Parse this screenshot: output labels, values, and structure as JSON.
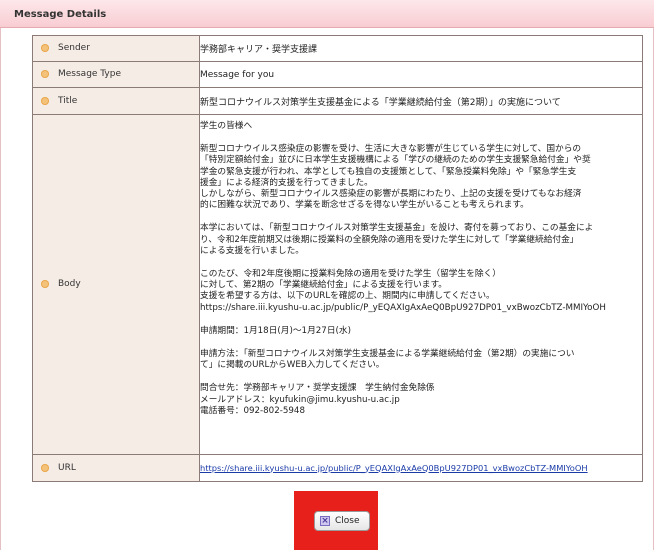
{
  "header": {
    "title": "Message Details"
  },
  "fields": {
    "sender": {
      "label": "Sender",
      "value": "学務部キャリア・奨学支援課"
    },
    "type": {
      "label": "Message Type",
      "value": "Message for you"
    },
    "title": {
      "label": "Title",
      "value": "新型コロナウイルス対策学生支援基金による「学業継続給付金（第2期）」の実施について"
    },
    "body": {
      "label": "Body",
      "greeting": "学生の皆様へ",
      "para1": [
        "新型コロナウイルス感染症の影響を受け、生活に大きな影響が生じている学生に対して、国からの",
        "「特別定額給付金」並びに日本学生支援機構による「学びの継続のための学生支援緊急給付金」や奨",
        "学金の緊急支援が行われ、本学としても独自の支援策として、「緊急授業料免除」や「緊急学生支",
        "援金」による経済的支援を行ってきました。",
        "しかしながら、新型コロナウイルス感染症の影響が長期にわたり、上記の支援を受けてもなお経済",
        "的に困難な状況であり、学業を断念せざるを得ない学生がいることも考えられます。"
      ],
      "para2": [
        "本学においては、「新型コロナウイルス対策学生支援基金」を設け、寄付を募っており、この基金によ",
        "り、令和2年度前期又は後期に授業料の全額免除の適用を受けた学生に対して「学業継続給付金」",
        "による支援を行いました。"
      ],
      "para3": [
        "このたび、令和2年度後期に授業料免除の適用を受けた学生（留学生を除く）",
        "に対して、第2期の「学業継続給付金」による支援を行います。",
        "支援を希望する方は、以下のURLを確認の上、期間内に申請してください。",
        "https://share.iii.kyushu-u.ac.jp/public/P_yEQAXIgAxAeQ0BpU927DP01_vxBwozCbTZ-MMIYoOH"
      ],
      "period": "申請期間：1月18日(月)～1月27日(水)",
      "method": [
        "申請方法：「新型コロナウイルス対策学生支援基金による学業継続給付金（第2期）の実施につい",
        "て」に掲載のURLからWEB入力してください。"
      ],
      "contact": [
        "問合せ先：学務部キャリア・奨学支援課　学生納付金免除係",
        "メールアドレス：kyufukin@jimu.kyushu-u.ac.jp",
        "電話番号：092-802-5948"
      ]
    },
    "url": {
      "label": "URL",
      "value": "https://share.iii.kyushu-u.ac.jp/public/P_yEQAXIgAxAeQ0BpU927DP01_vxBwozCbTZ-MMIYoOH"
    }
  },
  "close_button": {
    "label": "Close"
  },
  "colors": {
    "header_bg": "#f8cdd2",
    "label_bg": "#f6ece6",
    "bullet": "#f4c27a",
    "highlight": "#e8201c",
    "link": "#1a3aa8"
  }
}
